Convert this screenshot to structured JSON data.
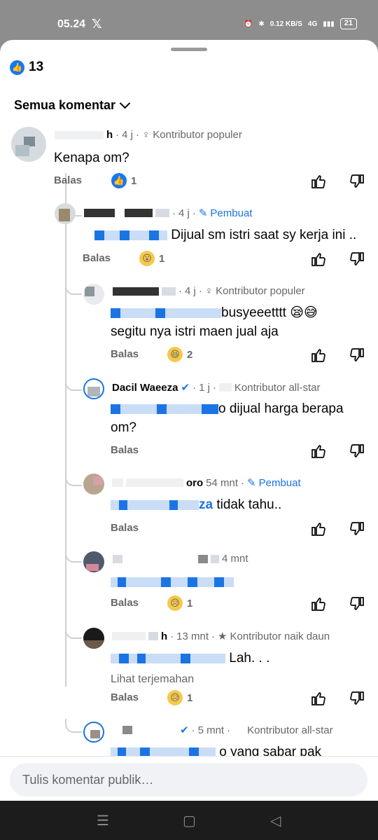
{
  "status_bar": {
    "time": "05.24",
    "x_glyph": "𝕏",
    "net_speed": "0.12 KB/S",
    "signal": "4G",
    "battery": "21"
  },
  "reactions": {
    "count": "13"
  },
  "filter": {
    "label": "Semua komentar"
  },
  "comments": [
    {
      "meta_name": "h",
      "time": "4 j",
      "badge": "Kontributor populer",
      "text": "Kenapa om?",
      "reply_label": "Balas",
      "react_count": "1",
      "react_emoji": "👍"
    },
    {
      "time": "4 j",
      "badge": "Pembuat",
      "text": "Dijual sm istri saat sy kerja ini ..",
      "reply_label": "Balas",
      "react_count": "1",
      "react_emoji": "😮"
    },
    {
      "time": "4 j",
      "badge": "Kontributor populer",
      "text_line1": "busyeeetttt 😪😅",
      "text_line2": "segitu nya istri maen jual aja",
      "reply_label": "Balas",
      "react_count": "2",
      "react_emoji": "😆"
    },
    {
      "name": "Dacil Waeeza",
      "time": "1 j",
      "badge": "Kontributor all-star",
      "text_line1": "o dijual harga berapa",
      "text_line2": "om?",
      "reply_label": "Balas"
    },
    {
      "name_suffix": "oro",
      "time": "54 mnt",
      "badge": "Pembuat",
      "text": "tidak tahu..",
      "text_prefix": "za",
      "reply_label": "Balas"
    },
    {
      "time": "4 mnt",
      "reply_label": "Balas",
      "react_count": "1",
      "react_emoji": "😥"
    },
    {
      "name_suffix": "h",
      "time": "13 mnt",
      "badge": "Kontributor naik daun",
      "text": "Lah. . .",
      "translate": "Lihat terjemahan",
      "reply_label": "Balas",
      "react_count": "1",
      "react_emoji": "😥"
    },
    {
      "time": "5 mnt",
      "badge": "Kontributor all-star",
      "text": "o yang sabar pak"
    }
  ],
  "composer": {
    "placeholder": "Tulis komentar publik…"
  }
}
